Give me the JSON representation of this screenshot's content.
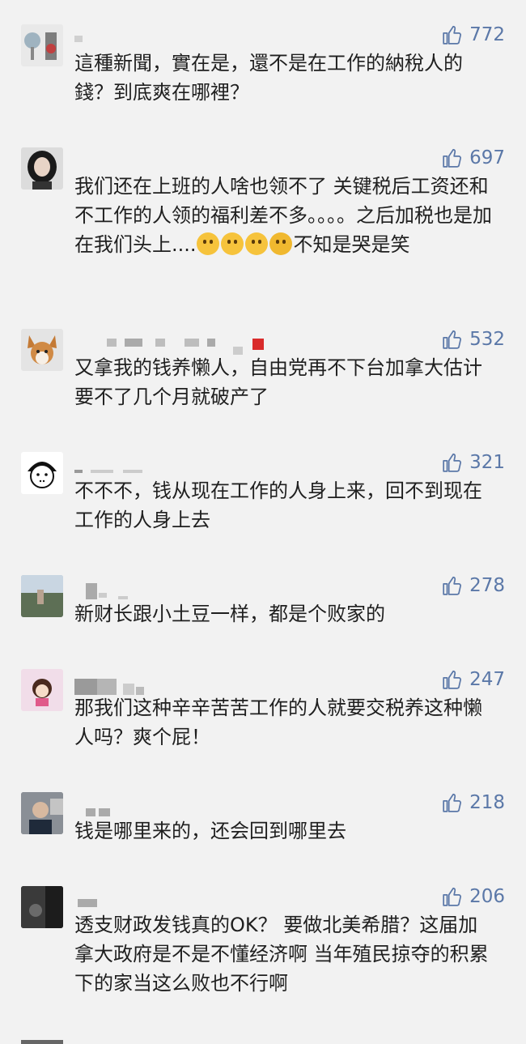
{
  "accent_color": "#5b78a8",
  "background": "#f2f2f2",
  "comments": [
    {
      "likes": "772",
      "text": "這種新聞，實在是，還不是在工作的納稅人的錢？到底爽在哪裡？",
      "avatar_icon": "desk-fan-avatar"
    },
    {
      "likes": "697",
      "text": "我们还在上班的人啥也领不了 关键税后工资还和不工作的人领的福利差不多。。。。之后加税也是加在我们头上....",
      "text_tail": "不知是哭是笑",
      "emojis": [
        "thinking-face-icon",
        "thinking-face-icon",
        "monocle-face-icon",
        "frowning-face-icon"
      ],
      "avatar_icon": "girl-portrait-avatar"
    },
    {
      "likes": "532",
      "text": "又拿我的钱养懒人，自由党再不下台加拿大估计要不了几个月就破产了",
      "avatar_icon": "corgi-dog-avatar"
    },
    {
      "likes": "321",
      "text": "不不不，钱从现在工作的人身上来，回不到现在工作的人身上去",
      "avatar_icon": "cartoon-face-avatar"
    },
    {
      "likes": "278",
      "text": "新财长跟小土豆一样，都是个败家的",
      "avatar_icon": "coast-photo-avatar"
    },
    {
      "likes": "247",
      "text": "那我们这种辛辛苦苦工作的人就要交税养这种懒人吗？爽个屁！",
      "avatar_icon": "cartoon-girl-avatar"
    },
    {
      "likes": "218",
      "text": "钱是哪里来的，还会回到哪里去",
      "avatar_icon": "man-portrait-avatar"
    },
    {
      "likes": "206",
      "text": "透支财政发钱真的OK？ 要做北美希腊？这届加拿大政府是不是不懂经济啊 当年殖民掠夺的积累下的家当这么败也不行啊",
      "avatar_icon": "dark-photo-avatar"
    }
  ]
}
